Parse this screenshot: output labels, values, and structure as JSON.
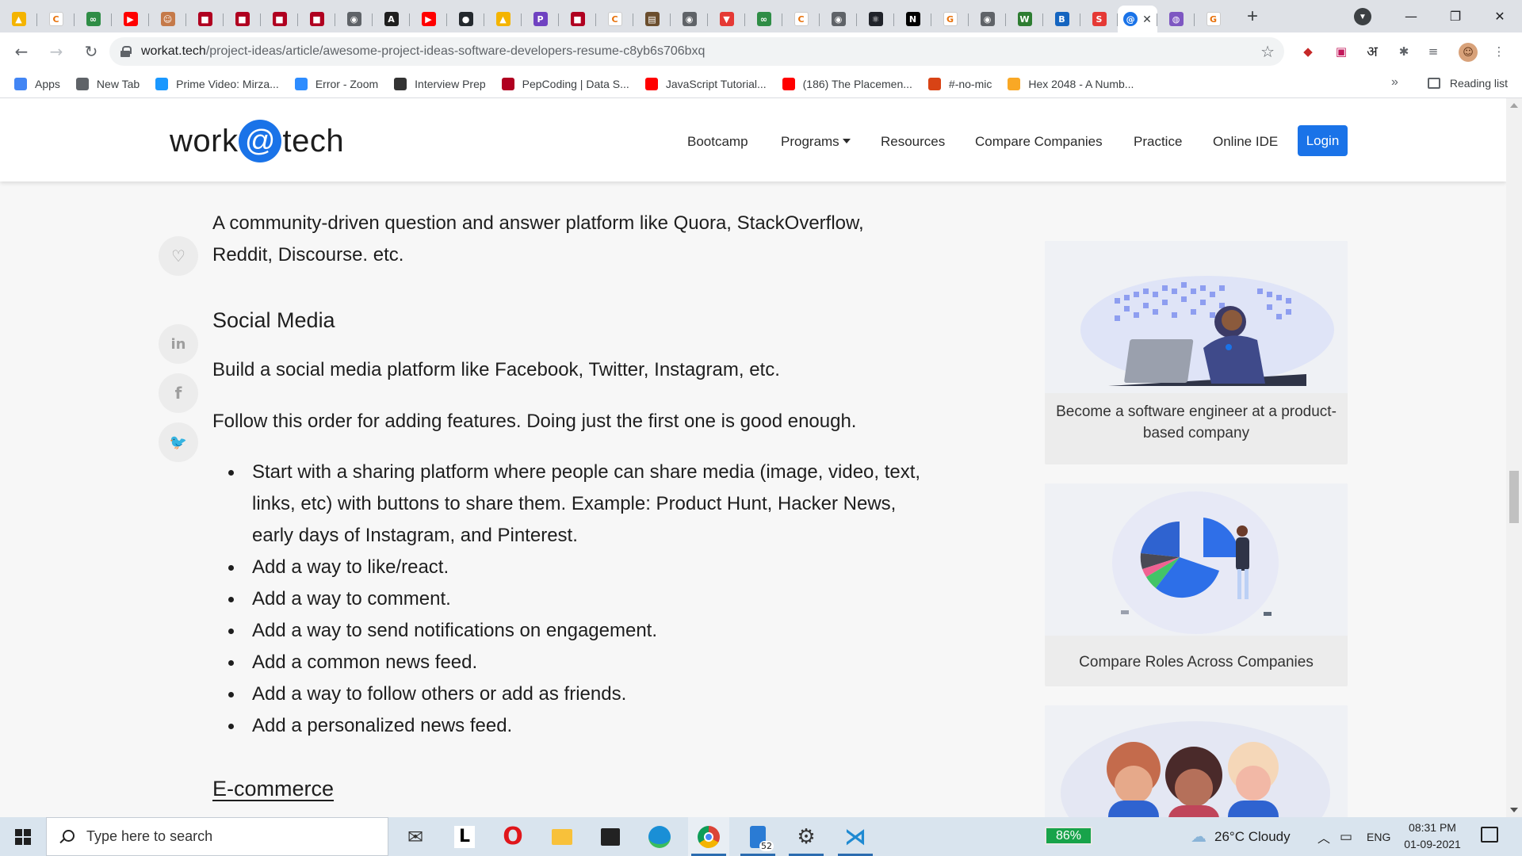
{
  "browser": {
    "tabs": [
      {
        "icon": "google-drive-icon",
        "color": "#f4b400",
        "glyph": "▲"
      },
      {
        "icon": "codechef-icon",
        "color": "#ffffff",
        "glyph": "C"
      },
      {
        "icon": "gfg-icon",
        "color": "#2f8d46",
        "glyph": "∞"
      },
      {
        "icon": "youtube-icon",
        "color": "#ff0000",
        "glyph": "▶"
      },
      {
        "icon": "avatar-icon",
        "color": "#c57a4a",
        "glyph": "☺"
      },
      {
        "icon": "pepcoding-icon",
        "color": "#b00020",
        "glyph": "■"
      },
      {
        "icon": "pepcoding-icon",
        "color": "#b00020",
        "glyph": "■"
      },
      {
        "icon": "pepcoding-icon",
        "color": "#b00020",
        "glyph": "■"
      },
      {
        "icon": "pepcoding-icon",
        "color": "#b00020",
        "glyph": "■"
      },
      {
        "icon": "chrome-grey-icon",
        "color": "#5f6368",
        "glyph": "◉"
      },
      {
        "icon": "algo-icon",
        "color": "#1f1f1f",
        "glyph": "A"
      },
      {
        "icon": "youtube-icon",
        "color": "#ff0000",
        "glyph": "▶"
      },
      {
        "icon": "github-icon",
        "color": "#24292e",
        "glyph": "●"
      },
      {
        "icon": "google-drive-icon",
        "color": "#f4b400",
        "glyph": "▲"
      },
      {
        "icon": "p-icon",
        "color": "#6f42c1",
        "glyph": "P"
      },
      {
        "icon": "pepcoding-icon",
        "color": "#b00020",
        "glyph": "■"
      },
      {
        "icon": "codechef-icon",
        "color": "#ffffff",
        "glyph": "C"
      },
      {
        "icon": "img-icon",
        "color": "#6b4e2e",
        "glyph": "▤"
      },
      {
        "icon": "chrome-grey-icon",
        "color": "#5f6368",
        "glyph": "◉"
      },
      {
        "icon": "v-icon",
        "color": "#e53935",
        "glyph": "▼"
      },
      {
        "icon": "gfg-icon",
        "color": "#2f8d46",
        "glyph": "∞"
      },
      {
        "icon": "codechef-icon",
        "color": "#ffffff",
        "glyph": "C"
      },
      {
        "icon": "chrome-grey-icon",
        "color": "#5f6368",
        "glyph": "◉"
      },
      {
        "icon": "react-icon",
        "color": "#20232a",
        "glyph": "⚛"
      },
      {
        "icon": "notion-icon",
        "color": "#000000",
        "glyph": "N"
      },
      {
        "icon": "google-icon",
        "color": "#ffffff",
        "glyph": "G"
      },
      {
        "icon": "chrome-grey-icon",
        "color": "#5f6368",
        "glyph": "◉"
      },
      {
        "icon": "w-icon",
        "color": "#2e7d32",
        "glyph": "W"
      },
      {
        "icon": "b-icon",
        "color": "#1565c0",
        "glyph": "B"
      },
      {
        "icon": "s-icon",
        "color": "#e53935",
        "glyph": "S"
      },
      {
        "icon": "planet-icon",
        "color": "#7e57c2",
        "glyph": "◍"
      },
      {
        "icon": "google-icon",
        "color": "#ffffff",
        "glyph": "G"
      }
    ],
    "active_tab_icon": "workattech-icon",
    "url_host": "workat.tech",
    "url_path": "/project-ideas/article/awesome-project-ideas-software-developers-resume-c8yb6s706bxq",
    "bookmarks": [
      {
        "label": "Apps",
        "icon": "apps-grid-icon",
        "color": "#4285f4"
      },
      {
        "label": "New Tab",
        "icon": "globe-icon",
        "color": "#5f6368"
      },
      {
        "label": "Prime Video: Mirza...",
        "icon": "prime-video-icon",
        "color": "#1a98ff"
      },
      {
        "label": "Error - Zoom",
        "icon": "zoom-icon",
        "color": "#2d8cff"
      },
      {
        "label": "Interview Prep",
        "icon": "td-icon",
        "color": "#333333"
      },
      {
        "label": "PepCoding | Data S...",
        "icon": "pepcoding-icon",
        "color": "#b00020"
      },
      {
        "label": "JavaScript Tutorial...",
        "icon": "youtube-icon",
        "color": "#ff0000"
      },
      {
        "label": "(186) The Placemen...",
        "icon": "youtube-icon",
        "color": "#ff0000"
      },
      {
        "label": "#⁠-no-mic",
        "icon": "discord-badge-icon",
        "color": "#d84315"
      },
      {
        "label": "Hex 2048 - A Numb...",
        "icon": "hex-icon",
        "color": "#f9a825"
      }
    ],
    "bookmarks_more": "»",
    "reading_list": "Reading list",
    "ext_letter": "अ"
  },
  "site": {
    "logo_left": "work",
    "logo_at": "@",
    "logo_right": "tech",
    "nav": [
      "Bootcamp",
      "Programs",
      "Resources",
      "Compare Companies",
      "Practice",
      "Online IDE"
    ],
    "login": "Login",
    "accent": "#1a73e8"
  },
  "article": {
    "intro": "A community-driven question and answer platform like Quora, StackOverflow, Reddit, Discourse. etc.",
    "heading": "Social Media",
    "p1": "Build a social media platform like Facebook, Twitter, Instagram, etc.",
    "p2": "Follow this order for adding features. Doing just the first one is good enough.",
    "features": [
      "Start with a sharing platform where people can share media (image, video, text, links, etc) with buttons to share them. Example: Product Hunt, Hacker News, early days of Instagram, and Pinterest.",
      "Add a way to like/react.",
      "Add a way to comment.",
      "Add a way to send notifications on engagement.",
      "Add a common news feed.",
      "Add a way to follow others or add as friends.",
      "Add a personalized news feed."
    ],
    "next_heading": "E-commerce"
  },
  "share": [
    {
      "icon": "heart-icon",
      "glyph": "♡"
    },
    {
      "icon": "linkedin-icon",
      "glyph": "in"
    },
    {
      "icon": "facebook-icon",
      "glyph": "f"
    },
    {
      "icon": "twitter-icon",
      "glyph": "🐦"
    }
  ],
  "sidebar": {
    "card1": "Become a software engineer at a product-based company",
    "card2": "Compare Roles Across Companies"
  },
  "taskbar": {
    "search_placeholder": "Type here to search",
    "battery": "86%",
    "weather": "26°C  Cloudy",
    "language": "ENG",
    "time": "08:31 PM",
    "date": "01-09-2021",
    "store_badge": "52"
  }
}
